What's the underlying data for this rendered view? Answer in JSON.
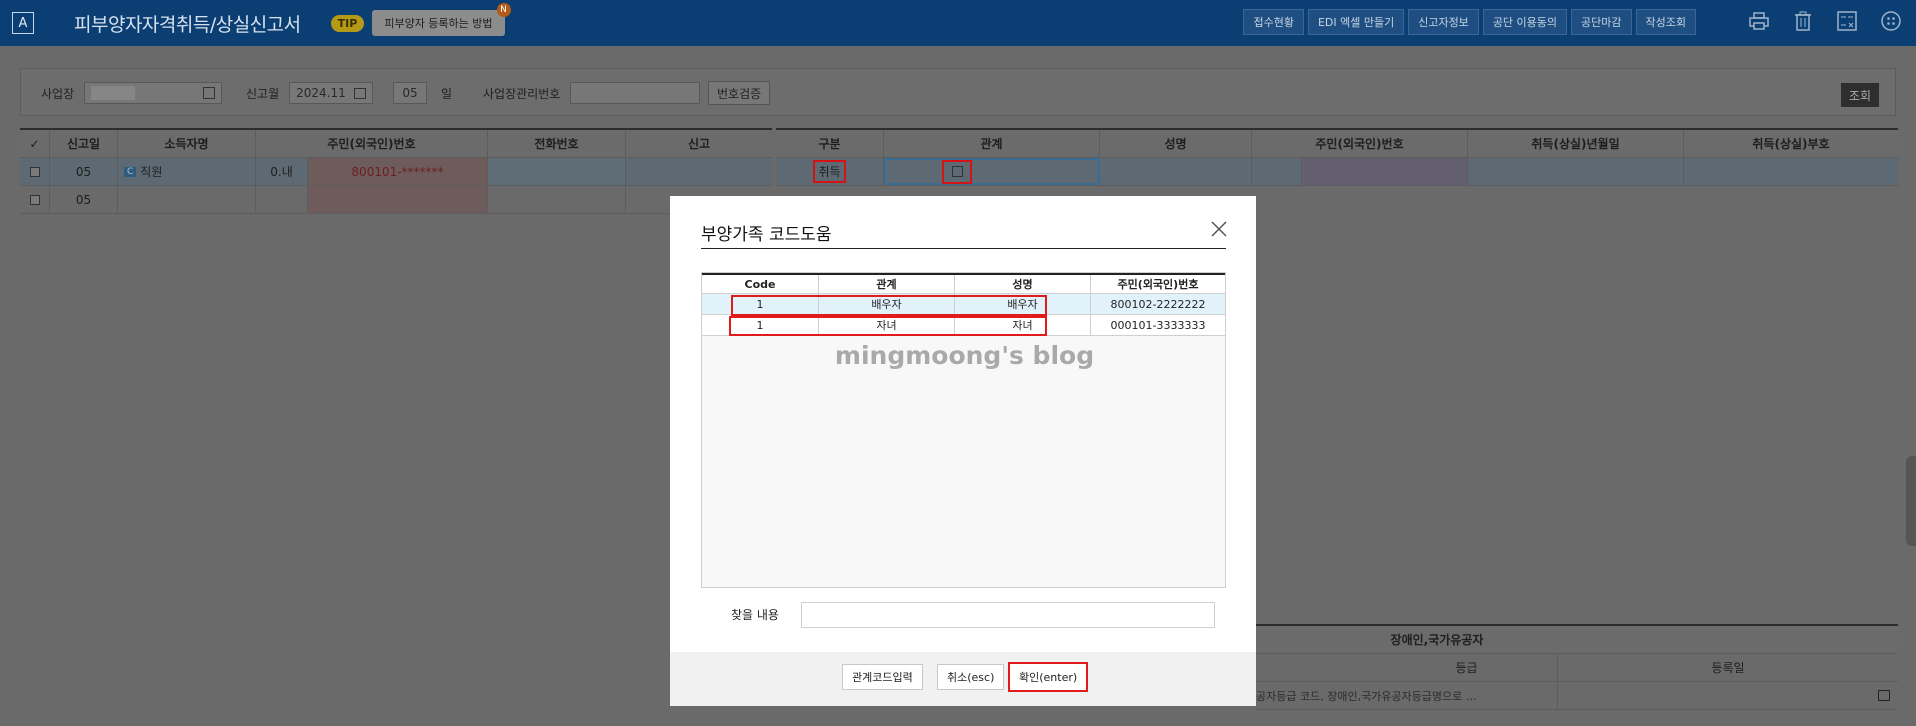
{
  "header": {
    "logo": "A",
    "title": "피부양자자격취득/상실신고서",
    "tip_badge": "TIP",
    "tip_text": "피부양자 등록하는 방법",
    "tip_notice": "N",
    "buttons": [
      "접수현황",
      "EDI 엑셀 만들기",
      "신고자정보",
      "공단 이용동의",
      "공단마감",
      "작성조회"
    ]
  },
  "search": {
    "workplace_label": "사업장",
    "month_label": "신고월",
    "month_value": "2024.11",
    "day_value": "05",
    "day_unit": "일",
    "manage_no_label": "사업장관리번호",
    "verify_button": "번호검증",
    "search_button": "조회"
  },
  "left_grid": {
    "headers": [
      "신고일",
      "소득자명",
      "주민(외국인)번호",
      "전화번호",
      "신고"
    ],
    "rows": [
      {
        "day": "05",
        "tag": "C",
        "name": "직원",
        "type": "0.내",
        "id": "800101-*******"
      },
      {
        "day": "05",
        "tag": "",
        "name": "",
        "type": "",
        "id": ""
      }
    ]
  },
  "right_grid": {
    "headers": [
      "구분",
      "관계",
      "성명",
      "주민(외국인)번호",
      "취득(상실)년월일",
      "취득(상실)부호"
    ],
    "row": {
      "category": "취득"
    }
  },
  "disability": {
    "title": "장애인,국가유공자",
    "headers": [
      "등급",
      "등록일"
    ],
    "hint": "공자등급 코드, 장애인,국가유공자등급명으로 …"
  },
  "modal": {
    "title": "부양가족 코드도움",
    "table_headers": [
      "Code",
      "관계",
      "성명",
      "주민(외국인)번호"
    ],
    "rows": [
      {
        "code": "1",
        "relation": "배우자",
        "name": "배우자",
        "id": "800102-2222222"
      },
      {
        "code": "1",
        "relation": "자녀",
        "name": "자녀",
        "id": "000101-3333333"
      }
    ],
    "watermark": "mingmoong's blog",
    "find_label": "찾을 내용",
    "buttons": {
      "code_input": "관계코드입력",
      "cancel": "취소(esc)",
      "confirm": "확인(enter)"
    }
  }
}
